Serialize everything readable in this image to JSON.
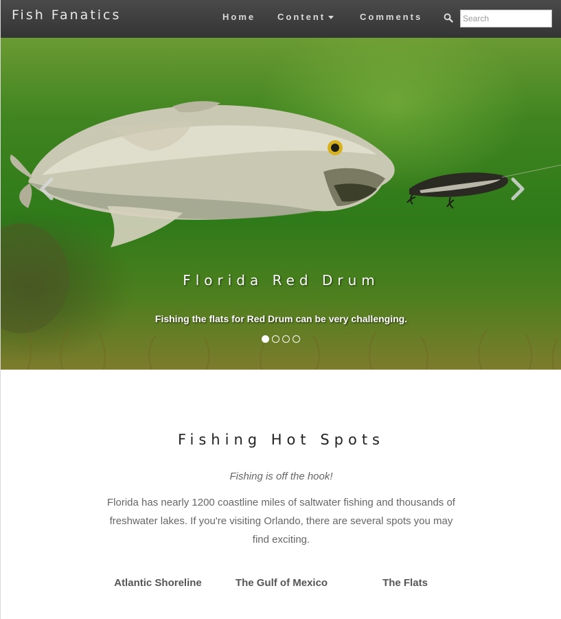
{
  "navbar": {
    "brand": "Fish Fanatics",
    "items": [
      {
        "label": "Home"
      },
      {
        "label": "Content",
        "has_dropdown": true
      },
      {
        "label": "Comments"
      }
    ],
    "search": {
      "placeholder": "Search",
      "value": "",
      "icon": "search-icon"
    }
  },
  "carousel": {
    "slide_title": "Florida Red Drum",
    "slide_caption": "Fishing the flats for Red Drum can be very challenging.",
    "slide_count": 4,
    "active_slide": 1,
    "prev_icon": "chevron-left-icon",
    "next_icon": "chevron-right-icon"
  },
  "main": {
    "title": "Fishing Hot Spots",
    "tagline": "Fishing is off the hook!",
    "intro": "Florida has nearly 1200 coastline miles of saltwater fishing and thousands of freshwater lakes. If you're visiting Orlando, there are several spots you may find exciting.",
    "spots": [
      {
        "label": "Atlantic Shoreline"
      },
      {
        "label": "The Gulf of Mexico"
      },
      {
        "label": "The Flats"
      }
    ]
  },
  "colors": {
    "navbar": "#3c3c3c",
    "water": "#2f7a1a",
    "heading": "#222222",
    "body_text": "#666666"
  }
}
